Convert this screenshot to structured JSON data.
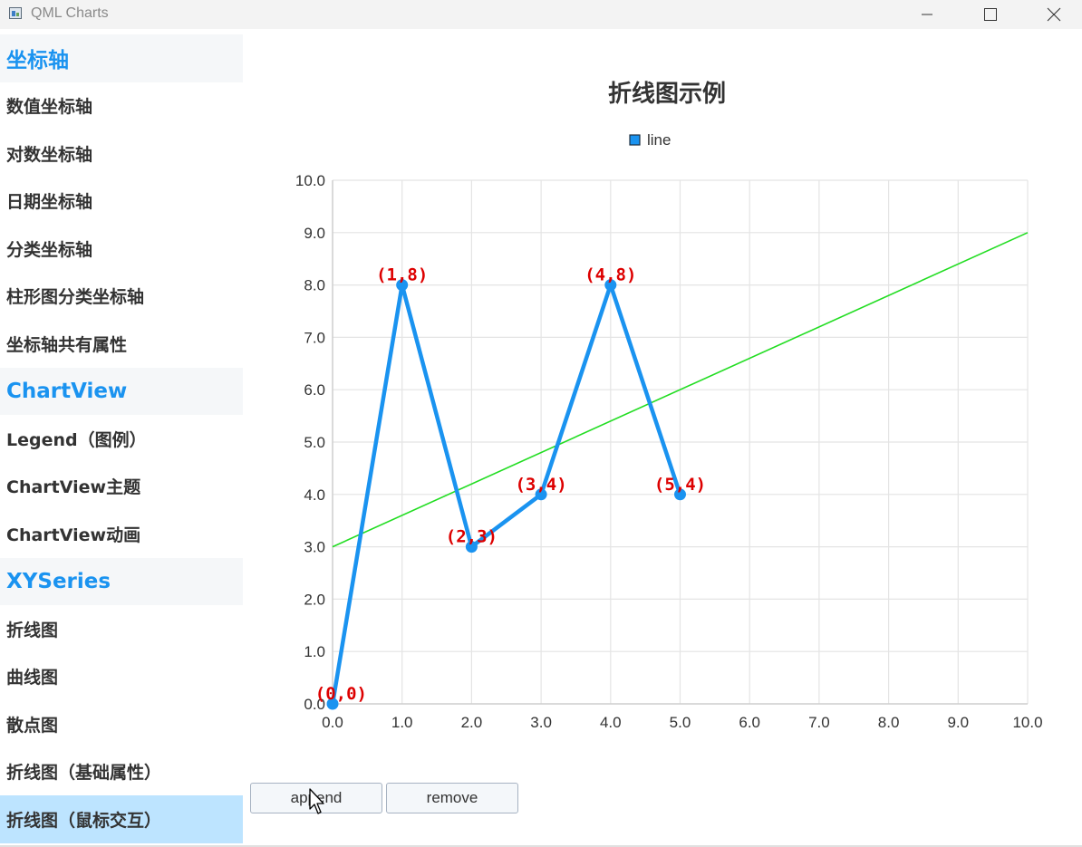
{
  "window": {
    "title": "QML Charts",
    "minimize_icon": "minimize-icon",
    "maximize_icon": "maximize-icon",
    "close_icon": "close-icon"
  },
  "sidebar": {
    "items": [
      {
        "label": "坐标轴",
        "type": "header"
      },
      {
        "label": "数值坐标轴",
        "type": "item"
      },
      {
        "label": "对数坐标轴",
        "type": "item"
      },
      {
        "label": "日期坐标轴",
        "type": "item"
      },
      {
        "label": "分类坐标轴",
        "type": "item"
      },
      {
        "label": "柱形图分类坐标轴",
        "type": "item"
      },
      {
        "label": "坐标轴共有属性",
        "type": "item"
      },
      {
        "label": "ChartView",
        "type": "header"
      },
      {
        "label": "Legend（图例）",
        "type": "item"
      },
      {
        "label": "ChartView主题",
        "type": "item"
      },
      {
        "label": "ChartView动画",
        "type": "item"
      },
      {
        "label": "XYSeries",
        "type": "header"
      },
      {
        "label": "折线图",
        "type": "item"
      },
      {
        "label": "曲线图",
        "type": "item"
      },
      {
        "label": "散点图",
        "type": "item"
      },
      {
        "label": "折线图（基础属性）",
        "type": "item"
      },
      {
        "label": "折线图（鼠标交互）",
        "type": "item",
        "selected": true
      }
    ],
    "header_color": "#1a93f0",
    "selected_color": "#bde4ff"
  },
  "buttons": {
    "append_label": "append",
    "remove_label": "remove"
  },
  "chart_data": {
    "type": "line",
    "title": "折线图示例",
    "xlabel": "",
    "ylabel": "",
    "xlim": [
      0,
      10
    ],
    "ylim": [
      0,
      10
    ],
    "grid": true,
    "legend": "top-center",
    "x_ticks": [
      "0.0",
      "1.0",
      "2.0",
      "3.0",
      "4.0",
      "5.0",
      "6.0",
      "7.0",
      "8.0",
      "9.0",
      "10.0"
    ],
    "y_ticks": [
      "0.0",
      "1.0",
      "2.0",
      "3.0",
      "4.0",
      "5.0",
      "6.0",
      "7.0",
      "8.0",
      "9.0",
      "10.0"
    ],
    "series": [
      {
        "name": "line",
        "color": "#1a93f0",
        "points": [
          [
            0,
            0
          ],
          [
            1,
            8
          ],
          [
            2,
            3
          ],
          [
            3,
            4
          ],
          [
            4,
            8
          ],
          [
            5,
            4
          ]
        ],
        "point_labels": [
          "(0,0)",
          "(1,8)",
          "(2,3)",
          "(3,4)",
          "(4,8)",
          "(5,4)"
        ],
        "label_color": "#dd0000"
      },
      {
        "color": "#22dd22",
        "points": [
          [
            0,
            3
          ],
          [
            10,
            9
          ]
        ]
      }
    ]
  }
}
